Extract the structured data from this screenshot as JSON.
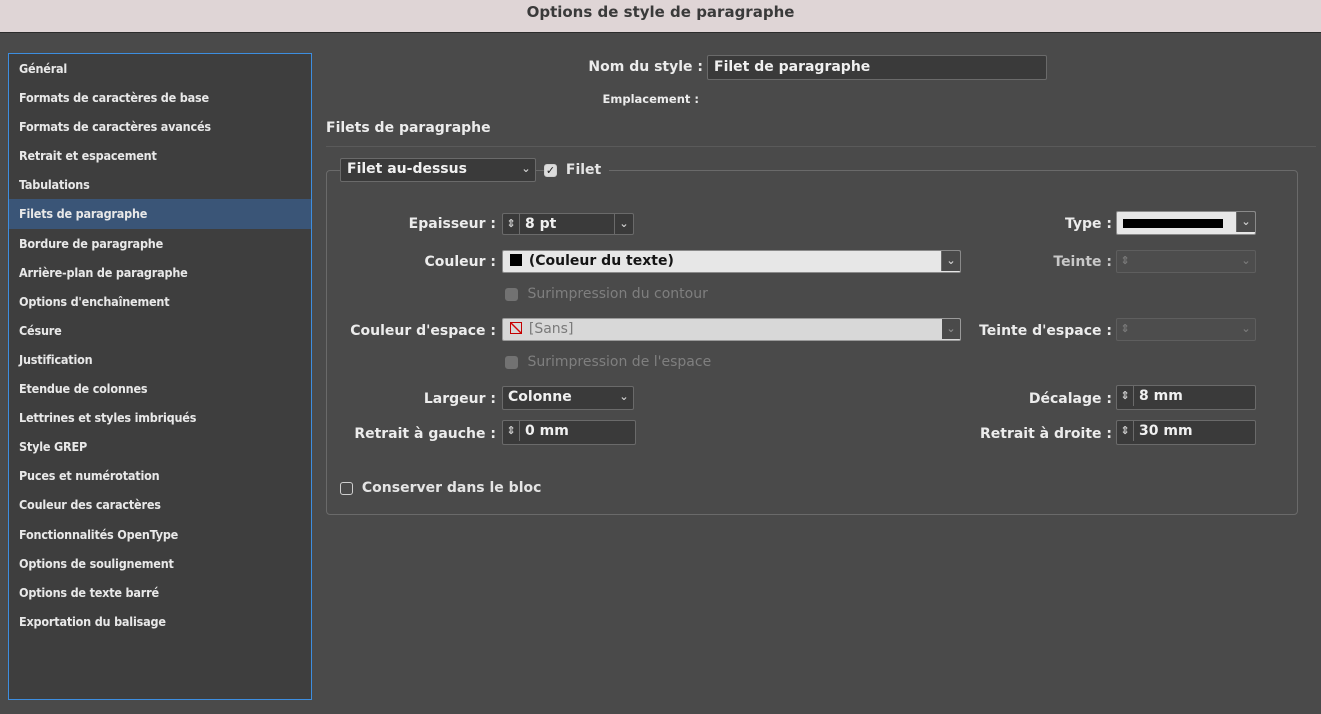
{
  "window": {
    "title": "Options de style de paragraphe"
  },
  "sidebar": {
    "items": [
      {
        "label": "Général"
      },
      {
        "label": "Formats de caractères de base"
      },
      {
        "label": "Formats de caractères avancés"
      },
      {
        "label": "Retrait et espacement"
      },
      {
        "label": "Tabulations"
      },
      {
        "label": "Filets de paragraphe",
        "selected": true
      },
      {
        "label": "Bordure de paragraphe"
      },
      {
        "label": "Arrière-plan de paragraphe"
      },
      {
        "label": "Options d'enchaînement"
      },
      {
        "label": "Césure"
      },
      {
        "label": "Justification"
      },
      {
        "label": "Etendue de colonnes"
      },
      {
        "label": "Lettrines et styles imbriqués"
      },
      {
        "label": "Style GREP"
      },
      {
        "label": "Puces et numérotation"
      },
      {
        "label": "Couleur des caractères"
      },
      {
        "label": "Fonctionnalités OpenType"
      },
      {
        "label": "Options de soulignement"
      },
      {
        "label": "Options de texte barré"
      },
      {
        "label": "Exportation du balisage"
      }
    ]
  },
  "header": {
    "style_name_label": "Nom du style :",
    "style_name_value": "Filet de paragraphe",
    "location_label": "Emplacement :",
    "section_title": "Filets de paragraphe"
  },
  "rule": {
    "position_select": "Filet au-dessus",
    "enable_label": "Filet",
    "enable_checked": true,
    "weight_label": "Epaisseur :",
    "weight_value": "8 pt",
    "type_label": "Type :",
    "color_label": "Couleur :",
    "color_value": "(Couleur du texte)",
    "tint_label": "Teinte :",
    "overprint_stroke_label": "Surimpression du contour",
    "gap_color_label": "Couleur d'espace :",
    "gap_color_value": "[Sans]",
    "gap_tint_label": "Teinte d'espace :",
    "overprint_gap_label": "Surimpression de l'espace",
    "width_label": "Largeur :",
    "width_value": "Colonne",
    "offset_label": "Décalage :",
    "offset_value": "8 mm",
    "left_indent_label": "Retrait à gauche :",
    "left_indent_value": "0 mm",
    "right_indent_label": "Retrait à droite :",
    "right_indent_value": "30 mm",
    "keep_in_frame_label": "Conserver dans le bloc",
    "keep_in_frame_checked": false
  },
  "icons": {
    "spinner": "updown-arrows-icon",
    "dropdown": "chevron-down-icon",
    "swatch_black": "black-swatch-icon",
    "swatch_none": "none-swatch-icon"
  },
  "colors": {
    "selection": "#3a5577",
    "focus_border": "#3d8ee0",
    "panel_bg": "#4a4a4a"
  }
}
